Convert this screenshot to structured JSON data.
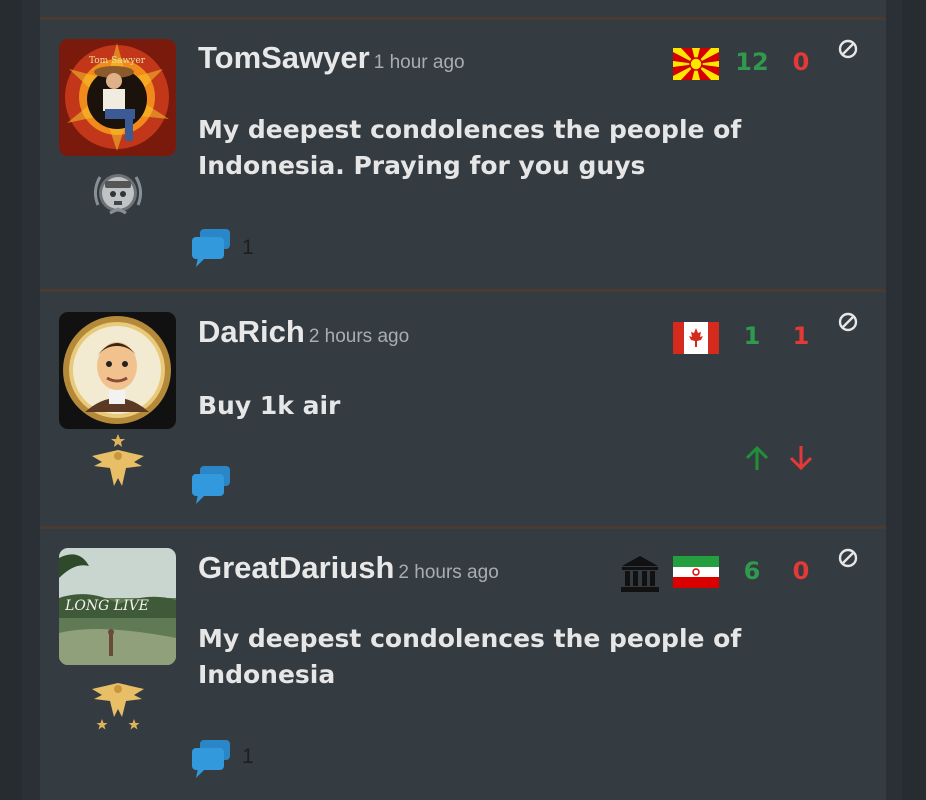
{
  "posts": [
    {
      "username": "TomSawyer",
      "time": "1 hour ago",
      "message": "My deepest condolences the people of Indonesia. Praying for you guys",
      "country_flag": "north-macedonia",
      "upvotes": "12",
      "downvotes": "0",
      "comment_count": "1",
      "avatar_text": "Tom Sawyer",
      "badge": "private-skull-badge"
    },
    {
      "username": "DaRich",
      "time": "2 hours ago",
      "message": "Buy 1k air",
      "country_flag": "canada",
      "upvotes": "1",
      "downvotes": "1",
      "comment_count": "",
      "badge": "gold-eagle-star-badge"
    },
    {
      "username": "GreatDariush",
      "time": "2 hours ago",
      "message": "My deepest condolences the people of Indonesia",
      "country_flag": "iran",
      "extra_icon": "government-building-icon",
      "upvotes": "6",
      "downvotes": "0",
      "comment_count": "1",
      "avatar_text": "LONG LIVE",
      "badge": "gold-eagle-stars-badge"
    }
  ],
  "colors": {
    "upvote": "#2f9a4e",
    "downvote": "#e53935",
    "comment_bubble": "#2f97d9",
    "card_bg": "#343c42"
  }
}
